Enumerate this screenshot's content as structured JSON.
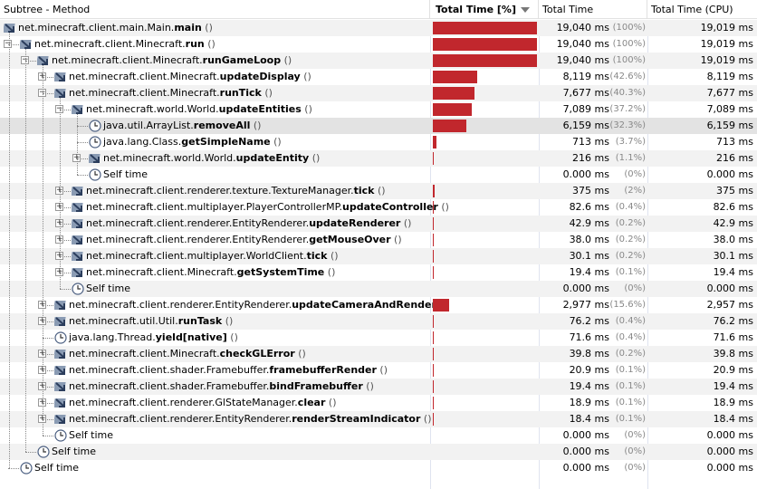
{
  "header": {
    "method": "Subtree - Method",
    "total_pct": "Total Time [%]",
    "total": "Total Time",
    "cpu": "Total Time (CPU)"
  },
  "colors": {
    "bar": "#c1272d",
    "selected": "#e3e3e3",
    "stripe": "#f2f2f2"
  },
  "rows": [
    {
      "level": 0,
      "exp": "",
      "icon": "method",
      "prefix": "net.minecraft.client.main.Main.",
      "name": "main",
      "args": " ()",
      "time": "19,040 ms",
      "pct": "(100%)",
      "cpu": "19,019 ms",
      "bar": 100
    },
    {
      "level": 1,
      "exp": "minus",
      "icon": "method",
      "prefix": "net.minecraft.client.Minecraft.",
      "name": "run",
      "args": " ()",
      "time": "19,040 ms",
      "pct": "(100%)",
      "cpu": "19,019 ms",
      "bar": 100
    },
    {
      "level": 2,
      "exp": "minus",
      "icon": "method",
      "prefix": "net.minecraft.client.Minecraft.",
      "name": "runGameLoop",
      "args": " ()",
      "time": "19,040 ms",
      "pct": "(100%)",
      "cpu": "19,019 ms",
      "bar": 100
    },
    {
      "level": 3,
      "exp": "plus",
      "icon": "method",
      "prefix": "net.minecraft.client.Minecraft.",
      "name": "updateDisplay",
      "args": " ()",
      "time": "8,119 ms",
      "pct": "(42.6%)",
      "cpu": "8,119 ms",
      "bar": 42.6
    },
    {
      "level": 3,
      "exp": "minus",
      "icon": "method",
      "prefix": "net.minecraft.client.Minecraft.",
      "name": "runTick",
      "args": " ()",
      "time": "7,677 ms",
      "pct": "(40.3%)",
      "cpu": "7,677 ms",
      "bar": 40.3
    },
    {
      "level": 4,
      "exp": "minus",
      "icon": "method",
      "prefix": "net.minecraft.world.World.",
      "name": "updateEntities",
      "args": " ()",
      "time": "7,089 ms",
      "pct": "(37.2%)",
      "cpu": "7,089 ms",
      "bar": 37.2
    },
    {
      "level": 5,
      "exp": "",
      "icon": "clock",
      "prefix": "java.util.ArrayList.",
      "name": "removeAll",
      "args": " ()",
      "time": "6,159 ms",
      "pct": "(32.3%)",
      "cpu": "6,159 ms",
      "bar": 32.3,
      "selected": true
    },
    {
      "level": 5,
      "exp": "",
      "icon": "clock",
      "prefix": "java.lang.Class.",
      "name": "getSimpleName",
      "args": " ()",
      "time": "713 ms",
      "pct": "(3.7%)",
      "cpu": "713 ms",
      "bar": 3.7
    },
    {
      "level": 5,
      "exp": "plus",
      "icon": "method",
      "prefix": "net.minecraft.world.World.",
      "name": "updateEntity",
      "args": " ()",
      "time": "216 ms",
      "pct": "(1.1%)",
      "cpu": "216 ms",
      "bar": 1.1
    },
    {
      "level": 5,
      "exp": "",
      "icon": "clock",
      "prefix": "Self time",
      "name": "",
      "args": "",
      "time": "0.000 ms",
      "pct": "(0%)",
      "cpu": "0.000 ms",
      "bar": 0
    },
    {
      "level": 4,
      "exp": "plus",
      "icon": "method",
      "prefix": "net.minecraft.client.renderer.texture.TextureManager.",
      "name": "tick",
      "args": " ()",
      "time": "375 ms",
      "pct": "(2%)",
      "cpu": "375 ms",
      "bar": 2
    },
    {
      "level": 4,
      "exp": "plus",
      "icon": "method",
      "prefix": "net.minecraft.client.multiplayer.PlayerControllerMP.",
      "name": "updateController",
      "args": " ()",
      "time": "82.6 ms",
      "pct": "(0.4%)",
      "cpu": "82.6 ms",
      "bar": 0.4
    },
    {
      "level": 4,
      "exp": "plus",
      "icon": "method",
      "prefix": "net.minecraft.client.renderer.EntityRenderer.",
      "name": "updateRenderer",
      "args": " ()",
      "time": "42.9 ms",
      "pct": "(0.2%)",
      "cpu": "42.9 ms",
      "bar": 0.2
    },
    {
      "level": 4,
      "exp": "plus",
      "icon": "method",
      "prefix": "net.minecraft.client.renderer.EntityRenderer.",
      "name": "getMouseOver",
      "args": " ()",
      "time": "38.0 ms",
      "pct": "(0.2%)",
      "cpu": "38.0 ms",
      "bar": 0.2
    },
    {
      "level": 4,
      "exp": "plus",
      "icon": "method",
      "prefix": "net.minecraft.client.multiplayer.WorldClient.",
      "name": "tick",
      "args": " ()",
      "time": "30.1 ms",
      "pct": "(0.2%)",
      "cpu": "30.1 ms",
      "bar": 0.2
    },
    {
      "level": 4,
      "exp": "plus",
      "icon": "method",
      "prefix": "net.minecraft.client.Minecraft.",
      "name": "getSystemTime",
      "args": " ()",
      "time": "19.4 ms",
      "pct": "(0.1%)",
      "cpu": "19.4 ms",
      "bar": 0.1
    },
    {
      "level": 4,
      "exp": "",
      "icon": "clock",
      "prefix": "Self time",
      "name": "",
      "args": "",
      "time": "0.000 ms",
      "pct": "(0%)",
      "cpu": "0.000 ms",
      "bar": 0
    },
    {
      "level": 3,
      "exp": "plus",
      "icon": "method",
      "prefix": "net.minecraft.client.renderer.EntityRenderer.",
      "name": "updateCameraAndRender",
      "args": " ()",
      "time": "2,977 ms",
      "pct": "(15.6%)",
      "cpu": "2,957 ms",
      "bar": 15.6
    },
    {
      "level": 3,
      "exp": "plus",
      "icon": "method",
      "prefix": "net.minecraft.util.Util.",
      "name": "runTask",
      "args": " ()",
      "time": "76.2 ms",
      "pct": "(0.4%)",
      "cpu": "76.2 ms",
      "bar": 0.4
    },
    {
      "level": 3,
      "exp": "",
      "icon": "clock",
      "prefix": "java.lang.Thread.",
      "name": "yield[native]",
      "args": " ()",
      "time": "71.6 ms",
      "pct": "(0.4%)",
      "cpu": "71.6 ms",
      "bar": 0.4
    },
    {
      "level": 3,
      "exp": "plus",
      "icon": "method",
      "prefix": "net.minecraft.client.Minecraft.",
      "name": "checkGLError",
      "args": " ()",
      "time": "39.8 ms",
      "pct": "(0.2%)",
      "cpu": "39.8 ms",
      "bar": 0.2
    },
    {
      "level": 3,
      "exp": "plus",
      "icon": "method",
      "prefix": "net.minecraft.client.shader.Framebuffer.",
      "name": "framebufferRender",
      "args": " ()",
      "time": "20.9 ms",
      "pct": "(0.1%)",
      "cpu": "20.9 ms",
      "bar": 0.1
    },
    {
      "level": 3,
      "exp": "plus",
      "icon": "method",
      "prefix": "net.minecraft.client.shader.Framebuffer.",
      "name": "bindFramebuffer",
      "args": " ()",
      "time": "19.4 ms",
      "pct": "(0.1%)",
      "cpu": "19.4 ms",
      "bar": 0.1
    },
    {
      "level": 3,
      "exp": "plus",
      "icon": "method",
      "prefix": "net.minecraft.client.renderer.GlStateManager.",
      "name": "clear",
      "args": " ()",
      "time": "18.9 ms",
      "pct": "(0.1%)",
      "cpu": "18.9 ms",
      "bar": 0.1
    },
    {
      "level": 3,
      "exp": "plus",
      "icon": "method",
      "prefix": "net.minecraft.client.renderer.EntityRenderer.",
      "name": "renderStreamIndicator",
      "args": " ()",
      "time": "18.4 ms",
      "pct": "(0.1%)",
      "cpu": "18.4 ms",
      "bar": 0.1
    },
    {
      "level": 3,
      "exp": "",
      "icon": "clock",
      "prefix": "Self time",
      "name": "",
      "args": "",
      "time": "0.000 ms",
      "pct": "(0%)",
      "cpu": "0.000 ms",
      "bar": 0
    },
    {
      "level": 2,
      "exp": "",
      "icon": "clock",
      "prefix": "Self time",
      "name": "",
      "args": "",
      "time": "0.000 ms",
      "pct": "(0%)",
      "cpu": "0.000 ms",
      "bar": 0
    },
    {
      "level": 1,
      "exp": "",
      "icon": "clock",
      "prefix": "Self time",
      "name": "",
      "args": "",
      "time": "0.000 ms",
      "pct": "(0%)",
      "cpu": "0.000 ms",
      "bar": 0
    }
  ]
}
